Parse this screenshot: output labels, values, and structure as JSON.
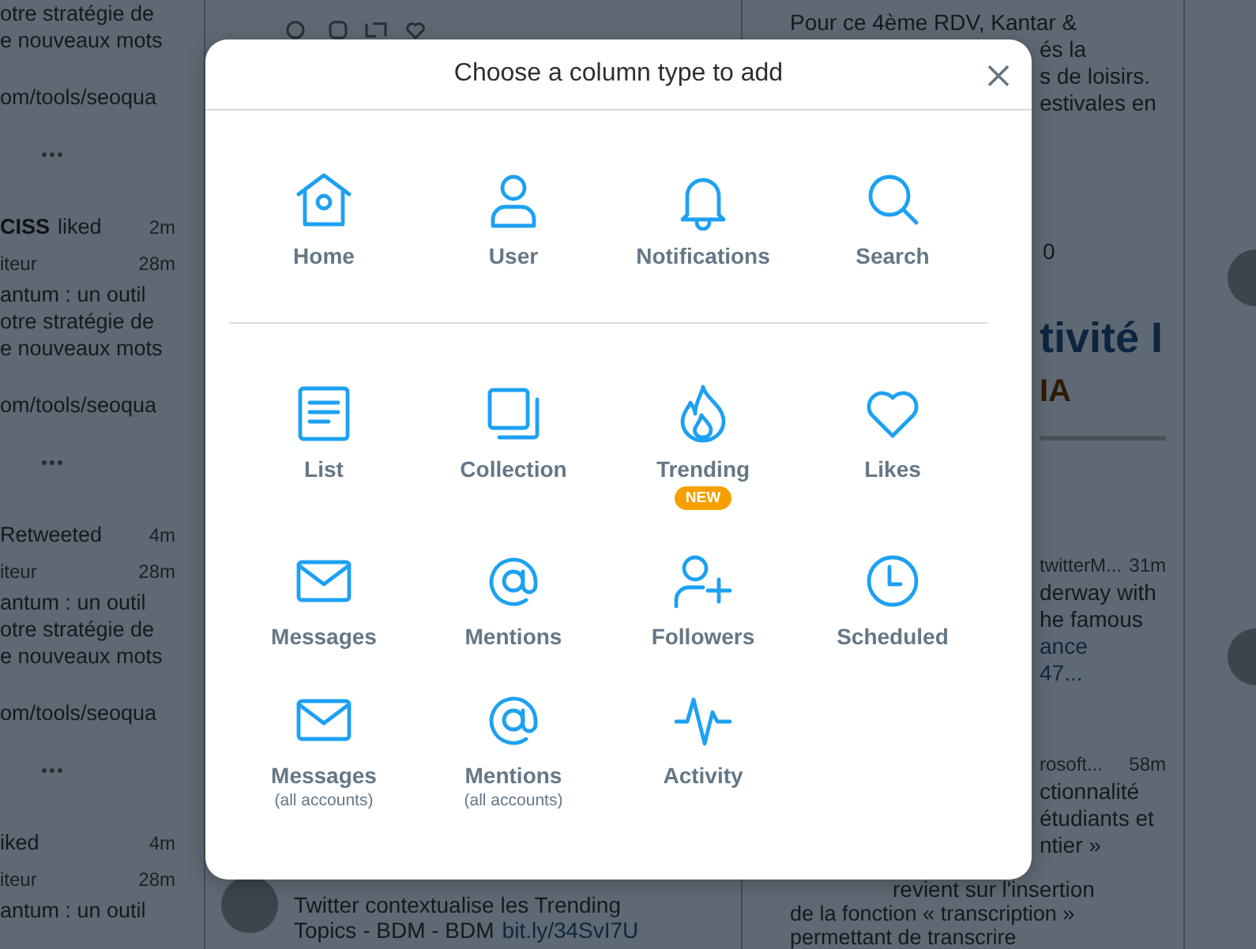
{
  "left_column": {
    "items": [
      {
        "kind": "line",
        "text": "otre stratégie de"
      },
      {
        "kind": "line",
        "text": "e nouveaux mots"
      },
      {
        "kind": "link",
        "text": "om/tools/seoqua"
      },
      {
        "kind": "more"
      },
      {
        "kind": "header",
        "name": "CISS",
        "action": "liked",
        "time": "2m"
      },
      {
        "kind": "meta",
        "text": "iteur",
        "time": "28m"
      },
      {
        "kind": "line",
        "text": "antum : un outil"
      },
      {
        "kind": "line",
        "text": "otre stratégie de"
      },
      {
        "kind": "line",
        "text": "e nouveaux mots"
      },
      {
        "kind": "link",
        "text": "om/tools/seoqua"
      },
      {
        "kind": "more"
      },
      {
        "kind": "header",
        "action": "Retweeted",
        "time": "4m"
      },
      {
        "kind": "meta",
        "text": "iteur",
        "time": "28m"
      },
      {
        "kind": "line",
        "text": "antum : un outil"
      },
      {
        "kind": "line",
        "text": "otre stratégie de"
      },
      {
        "kind": "line",
        "text": "e nouveaux mots"
      },
      {
        "kind": "link",
        "text": "om/tools/seoqua"
      },
      {
        "kind": "more"
      },
      {
        "kind": "header",
        "action": "iked",
        "time": "4m"
      },
      {
        "kind": "meta",
        "text": "iteur",
        "time": "28m"
      },
      {
        "kind": "line",
        "text": "antum : un outil"
      }
    ]
  },
  "middle_column": {
    "tweet": {
      "lines": [
        "Twitter contextualise les Trending"
      ],
      "last_line": "Topics - BDM - BDM",
      "link": "bit.ly/34SvI7U"
    }
  },
  "right_column": {
    "items": [
      {
        "kind": "line",
        "text": "Pour ce 4ème RDV, Kantar &"
      },
      {
        "kind": "fragment",
        "text": "és la"
      },
      {
        "kind": "fragment",
        "text": "s de loisirs."
      },
      {
        "kind": "fragment",
        "text": "estivales en"
      },
      {
        "kind": "count",
        "text": "0"
      },
      {
        "kind": "headline",
        "text": "tivité I"
      },
      {
        "kind": "subhead",
        "text": "IA"
      },
      {
        "kind": "meta",
        "text": "twitterM...",
        "time": "31m"
      },
      {
        "kind": "fragment",
        "text": "derway with"
      },
      {
        "kind": "fragment",
        "text": "he famous"
      },
      {
        "kind": "link",
        "text": "ance"
      },
      {
        "kind": "link",
        "text": "47..."
      },
      {
        "kind": "meta",
        "text": "rosoft...",
        "time": "58m"
      },
      {
        "kind": "fragment",
        "text": "ctionnalité"
      },
      {
        "kind": "fragment",
        "text": "étudiants et"
      },
      {
        "kind": "fragment",
        "text": "ntier »"
      },
      {
        "kind": "tail",
        "text": "revient sur l'insertion"
      },
      {
        "kind": "line",
        "text": "de la fonction « transcription »"
      },
      {
        "kind": "line",
        "text": "permettant de transcrire"
      }
    ]
  },
  "dialog": {
    "title": "Choose a column type to add",
    "sections": [
      {
        "items": [
          {
            "kind": "home",
            "label": "Home"
          },
          {
            "kind": "user",
            "label": "User"
          },
          {
            "kind": "notifications",
            "label": "Notifications"
          },
          {
            "kind": "search",
            "label": "Search"
          }
        ]
      },
      {
        "items": [
          {
            "kind": "list",
            "label": "List"
          },
          {
            "kind": "collection",
            "label": "Collection"
          },
          {
            "kind": "trending",
            "label": "Trending",
            "badge": "NEW"
          },
          {
            "kind": "likes",
            "label": "Likes"
          },
          {
            "kind": "messages",
            "label": "Messages"
          },
          {
            "kind": "mentions",
            "label": "Mentions"
          },
          {
            "kind": "followers",
            "label": "Followers"
          },
          {
            "kind": "scheduled",
            "label": "Scheduled"
          },
          {
            "kind": "messages",
            "label": "Messages",
            "sub": "(all accounts)"
          },
          {
            "kind": "mentions",
            "label": "Mentions",
            "sub": "(all accounts)"
          },
          {
            "kind": "activity",
            "label": "Activity"
          }
        ]
      }
    ]
  }
}
